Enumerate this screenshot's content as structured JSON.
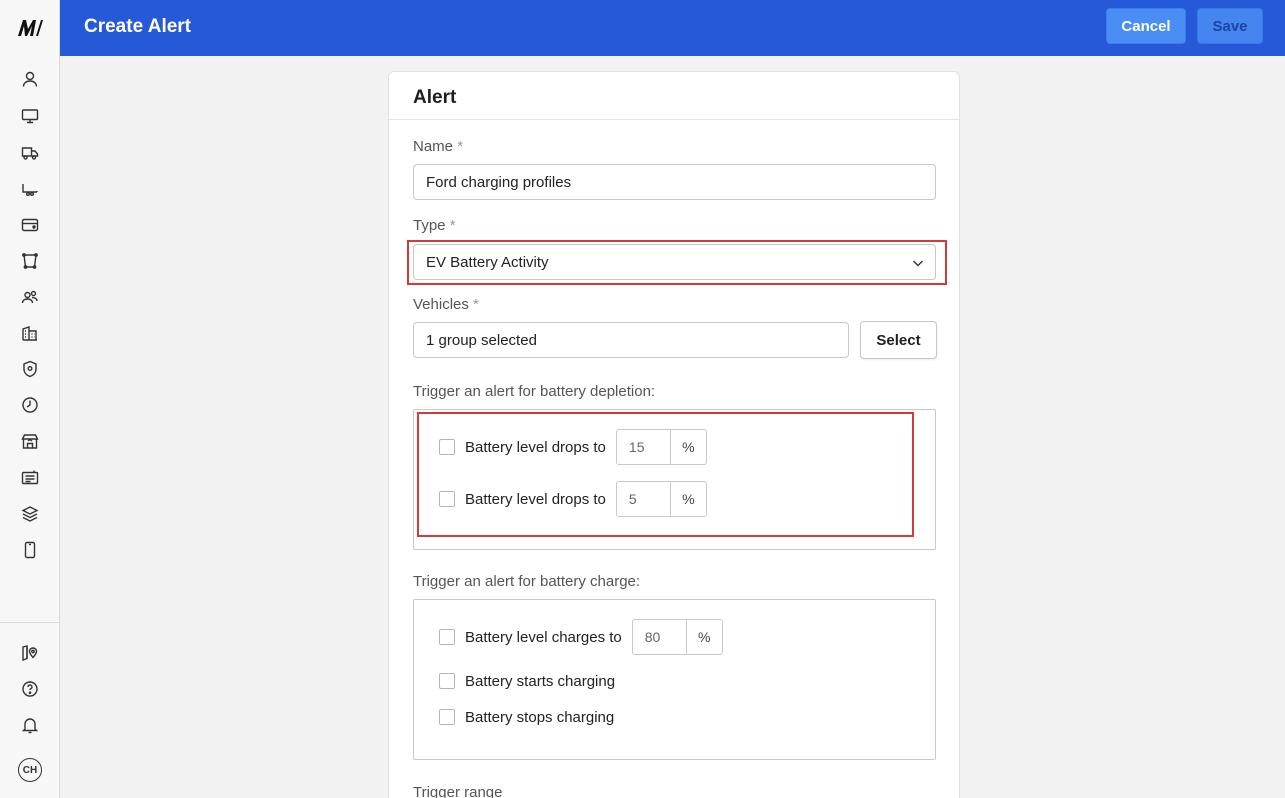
{
  "header": {
    "title": "Create Alert",
    "cancel_label": "Cancel",
    "save_label": "Save"
  },
  "sidebar": {
    "logo": "M",
    "avatar_initials": "CH",
    "items": [
      "user-icon",
      "monitor-icon",
      "truck-icon",
      "trailer-icon",
      "card-icon",
      "route-icon",
      "people-icon",
      "building-icon",
      "shield-icon",
      "clock-icon",
      "store-icon",
      "news-icon",
      "layers-icon",
      "phone-icon"
    ],
    "bottom_items": [
      "map-pin-icon",
      "help-icon",
      "bell-icon"
    ]
  },
  "form": {
    "card_title": "Alert",
    "required_mark": "*",
    "name_label": "Name",
    "name_value": "Ford charging profiles",
    "type_label": "Type",
    "type_value": "EV Battery Activity",
    "vehicles_label": "Vehicles",
    "vehicles_value": "1 group selected",
    "select_button": "Select",
    "depletion_label": "Trigger an alert for battery depletion:",
    "depletion_rows": [
      {
        "label": "Battery level drops to",
        "value": "15",
        "unit": "%",
        "checked": false
      },
      {
        "label": "Battery level drops to",
        "value": "5",
        "unit": "%",
        "checked": false
      }
    ],
    "charge_label": "Trigger an alert for battery charge:",
    "charge_level": {
      "label": "Battery level charges to",
      "value": "80",
      "unit": "%",
      "checked": false
    },
    "starts_charging": "Battery starts charging",
    "stops_charging": "Battery stops charging",
    "trigger_range_label": "Trigger range"
  },
  "colors": {
    "header_bg": "#2659d8",
    "button_bg": "#4a8df5",
    "highlight": "#d33b3b"
  }
}
